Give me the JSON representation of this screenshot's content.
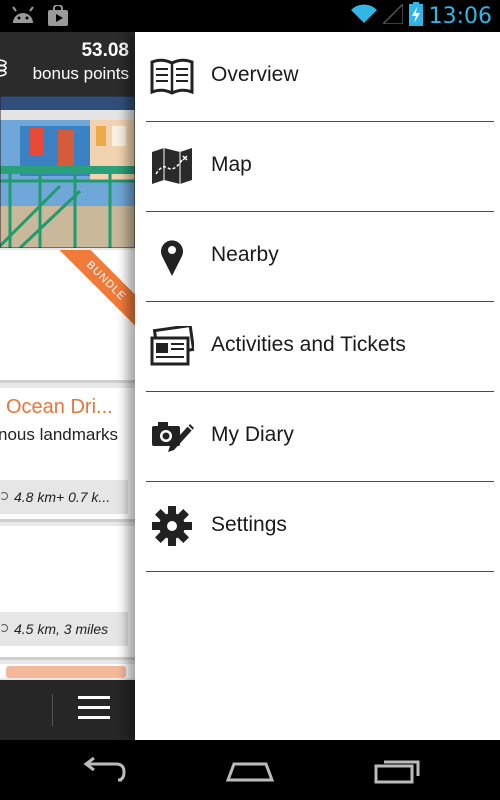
{
  "status_bar": {
    "time": "13:06",
    "icons": [
      "android-debug-icon",
      "store-notification-icon",
      "wifi-icon",
      "signal-icon",
      "battery-charging-icon"
    ]
  },
  "background_app": {
    "bonus_value": "53.08",
    "bonus_label": "bonus points",
    "ribbon_text": "BUNDLE",
    "tours": [
      {
        "title": "Ocean Dri...",
        "subtitle": "nous landmarks",
        "distance": "4.8 km+ 0.7 k..."
      },
      {
        "title": "",
        "subtitle": "",
        "distance": "4.5 km, 3 miles"
      }
    ],
    "accent_color": "#e8743b"
  },
  "drawer": {
    "items": [
      {
        "label": "Overview",
        "icon": "book-icon"
      },
      {
        "label": "Map",
        "icon": "map-icon"
      },
      {
        "label": "Nearby",
        "icon": "location-pin-icon"
      },
      {
        "label": "Activities and Tickets",
        "icon": "tickets-icon"
      },
      {
        "label": "My Diary",
        "icon": "camera-pencil-icon"
      },
      {
        "label": "Settings",
        "icon": "gear-icon"
      }
    ]
  },
  "nav_bar": {
    "buttons": [
      "back-button",
      "home-button",
      "recents-button"
    ]
  }
}
